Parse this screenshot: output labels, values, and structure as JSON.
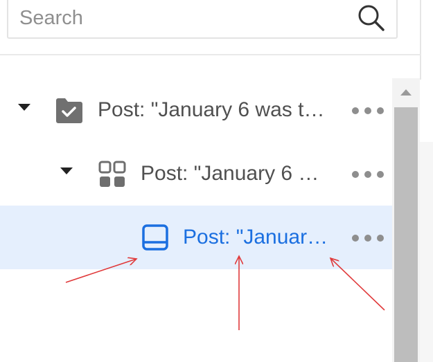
{
  "search": {
    "placeholder": "Search",
    "value": ""
  },
  "tree": {
    "rows": [
      {
        "label": "Post: \"January 6 was t…",
        "icon": "folder-check-icon",
        "expanded": true,
        "selected": false
      },
      {
        "label": "Post: \"January 6 …",
        "icon": "grid-icon",
        "expanded": true,
        "selected": false
      },
      {
        "label": "Post: \"Januar…",
        "icon": "tablet-icon",
        "expanded": false,
        "selected": true
      }
    ]
  },
  "colors": {
    "selected_bg": "#e5effd",
    "selected_text": "#1b6fe0",
    "text": "#505050",
    "annotation_arrow": "#e0393a"
  }
}
